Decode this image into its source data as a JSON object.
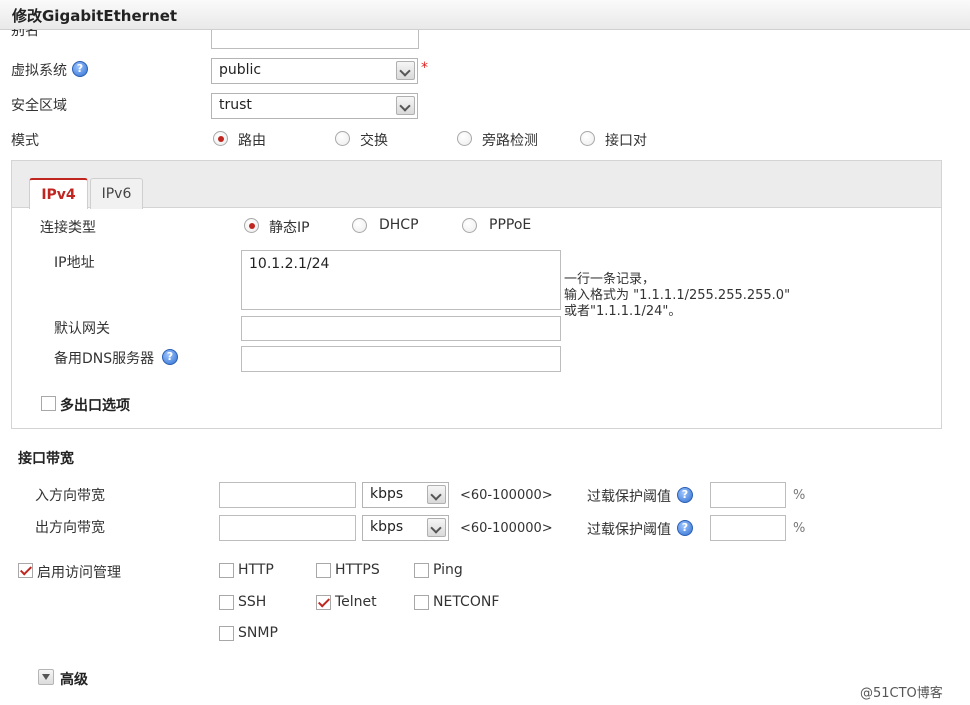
{
  "window": {
    "title": "修改GigabitEthernet"
  },
  "form": {
    "row_cut": {
      "label": "别名"
    },
    "vsys": {
      "label": "虚拟系统",
      "value": "public",
      "required_mark": "*"
    },
    "zone": {
      "label": "安全区域",
      "value": "trust"
    },
    "mode": {
      "label": "模式",
      "options": [
        {
          "label": "路由",
          "selected": true
        },
        {
          "label": "交换",
          "selected": false
        },
        {
          "label": "旁路检测",
          "selected": false
        },
        {
          "label": "接口对",
          "selected": false
        }
      ]
    }
  },
  "tabs": [
    {
      "label": "IPv4",
      "active": true
    },
    {
      "label": "IPv6",
      "active": false
    }
  ],
  "ipv4": {
    "conn_type": {
      "label": "连接类型",
      "options": [
        {
          "label": "静态IP",
          "selected": true
        },
        {
          "label": "DHCP",
          "selected": false
        },
        {
          "label": "PPPoE",
          "selected": false
        }
      ]
    },
    "ip": {
      "label": "IP地址",
      "value": "10.1.2.1/24",
      "hint_lines": [
        "一行一条记录，",
        "输入格式为 \"1.1.1.1/255.255.255.0\"",
        "或者\"1.1.1.1/24\"。"
      ]
    },
    "gateway": {
      "label": "默认网关",
      "value": ""
    },
    "dns": {
      "label": "备用DNS服务器",
      "value": ""
    },
    "multi_exit": {
      "label": "多出口选项",
      "checked": false
    }
  },
  "bandwidth": {
    "title": "接口带宽",
    "inbound": {
      "label": "入方向带宽",
      "unit": "kbps",
      "range": "<60-100000>",
      "overload_label": "过载保护阈值",
      "percent": "%"
    },
    "outbound": {
      "label": "出方向带宽",
      "unit": "kbps",
      "range": "<60-100000>",
      "overload_label": "过载保护阈值",
      "percent": "%"
    }
  },
  "access": {
    "label": "启用访问管理",
    "checked": true,
    "items": [
      {
        "label": "HTTP",
        "checked": false
      },
      {
        "label": "HTTPS",
        "checked": false
      },
      {
        "label": "Ping",
        "checked": false
      },
      {
        "label": "SSH",
        "checked": false
      },
      {
        "label": "Telnet",
        "checked": true
      },
      {
        "label": "NETCONF",
        "checked": false
      },
      {
        "label": "SNMP",
        "checked": false
      }
    ]
  },
  "advanced": {
    "label": "高级"
  },
  "watermark": "@51CTO博客",
  "help_glyph": "?",
  "colors": {
    "accent": "#c0261f",
    "help_blue": "#2f6fd1"
  }
}
